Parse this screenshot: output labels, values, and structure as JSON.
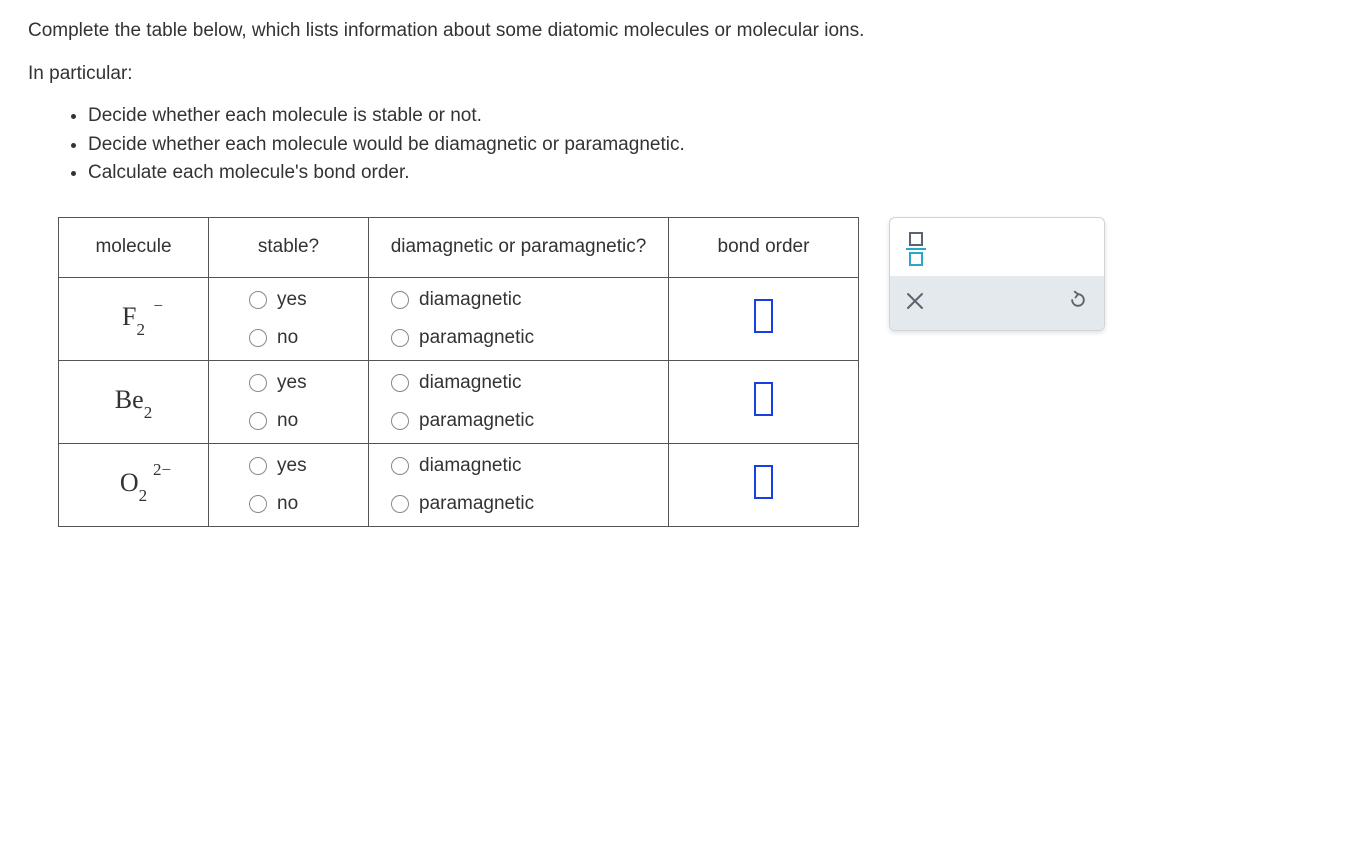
{
  "intro": {
    "line1": "Complete the table below, which lists information about some diatomic molecules or molecular ions.",
    "line2": "In particular:",
    "bullets": [
      "Decide whether each molecule is stable or not.",
      "Decide whether each molecule would be diamagnetic or paramagnetic.",
      "Calculate each molecule's bond order."
    ]
  },
  "table": {
    "headers": {
      "molecule": "molecule",
      "stable": "stable?",
      "magnetic": "diamagnetic or paramagnetic?",
      "bond_order": "bond order"
    },
    "options": {
      "yes": "yes",
      "no": "no",
      "diamagnetic": "diamagnetic",
      "paramagnetic": "paramagnetic"
    },
    "rows": [
      {
        "base": "F",
        "sub": "2",
        "sup": "−",
        "supclass": "sup"
      },
      {
        "base": "Be",
        "sub": "2",
        "sup": "",
        "supclass": ""
      },
      {
        "base": "O",
        "sub": "2",
        "sup": "2−",
        "supclass": "sup2"
      }
    ]
  },
  "toolbox": {
    "fraction_top_color": "#5a6470",
    "fraction_bar_color": "#2aa8c7",
    "fraction_bot_color": "#2aa8c7",
    "close": "×"
  }
}
